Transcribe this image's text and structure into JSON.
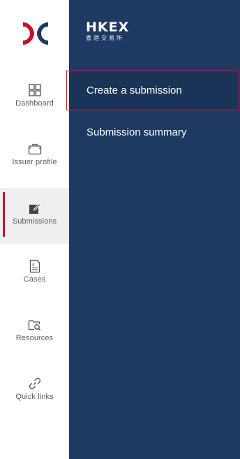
{
  "brand": {
    "logo_text": "HKEX",
    "logo_subtext": "香港交易所",
    "accent_color": "#c8102e",
    "panel_color": "#1f3a62"
  },
  "rail": {
    "items": [
      {
        "label": "Dashboard",
        "icon": "dashboard-grid-icon",
        "active": false
      },
      {
        "label": "Issuer profile",
        "icon": "briefcase-icon",
        "active": false
      },
      {
        "label": "Submissions",
        "icon": "edit-square-icon",
        "active": true
      },
      {
        "label": "Cases",
        "icon": "document-icon",
        "active": false
      },
      {
        "label": "Resources",
        "icon": "folder-search-icon",
        "active": false
      },
      {
        "label": "Quick links",
        "icon": "link-icon",
        "active": false
      }
    ]
  },
  "submenu": {
    "items": [
      {
        "label": "Create a submission",
        "selected": true
      },
      {
        "label": "Submission summary",
        "selected": false
      }
    ]
  }
}
